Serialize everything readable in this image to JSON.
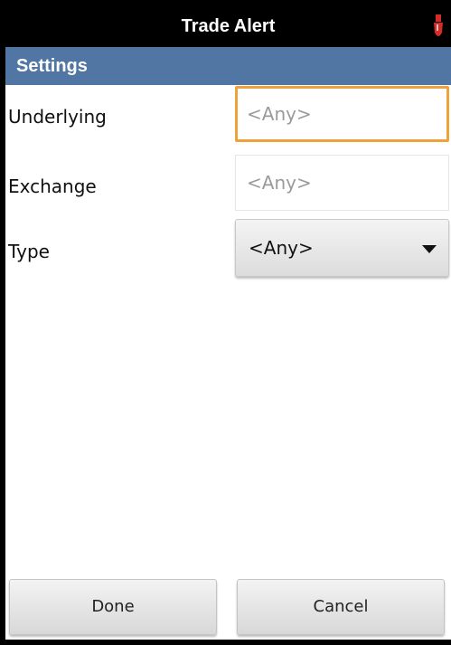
{
  "app": {
    "title": "Trade Alert",
    "icon": "alert-dropper-icon"
  },
  "section": {
    "title": "Settings"
  },
  "fields": {
    "underlying": {
      "label": "Underlying",
      "placeholder": "<Any>",
      "value": ""
    },
    "exchange": {
      "label": "Exchange",
      "placeholder": "<Any>",
      "value": ""
    },
    "type": {
      "label": "Type",
      "selected": "<Any>"
    }
  },
  "buttons": {
    "done": "Done",
    "cancel": "Cancel"
  },
  "colors": {
    "title_bar": "#000000",
    "header": "#5176a3",
    "focus_border": "#f0a23a",
    "icon_red": "#d62b2b"
  }
}
